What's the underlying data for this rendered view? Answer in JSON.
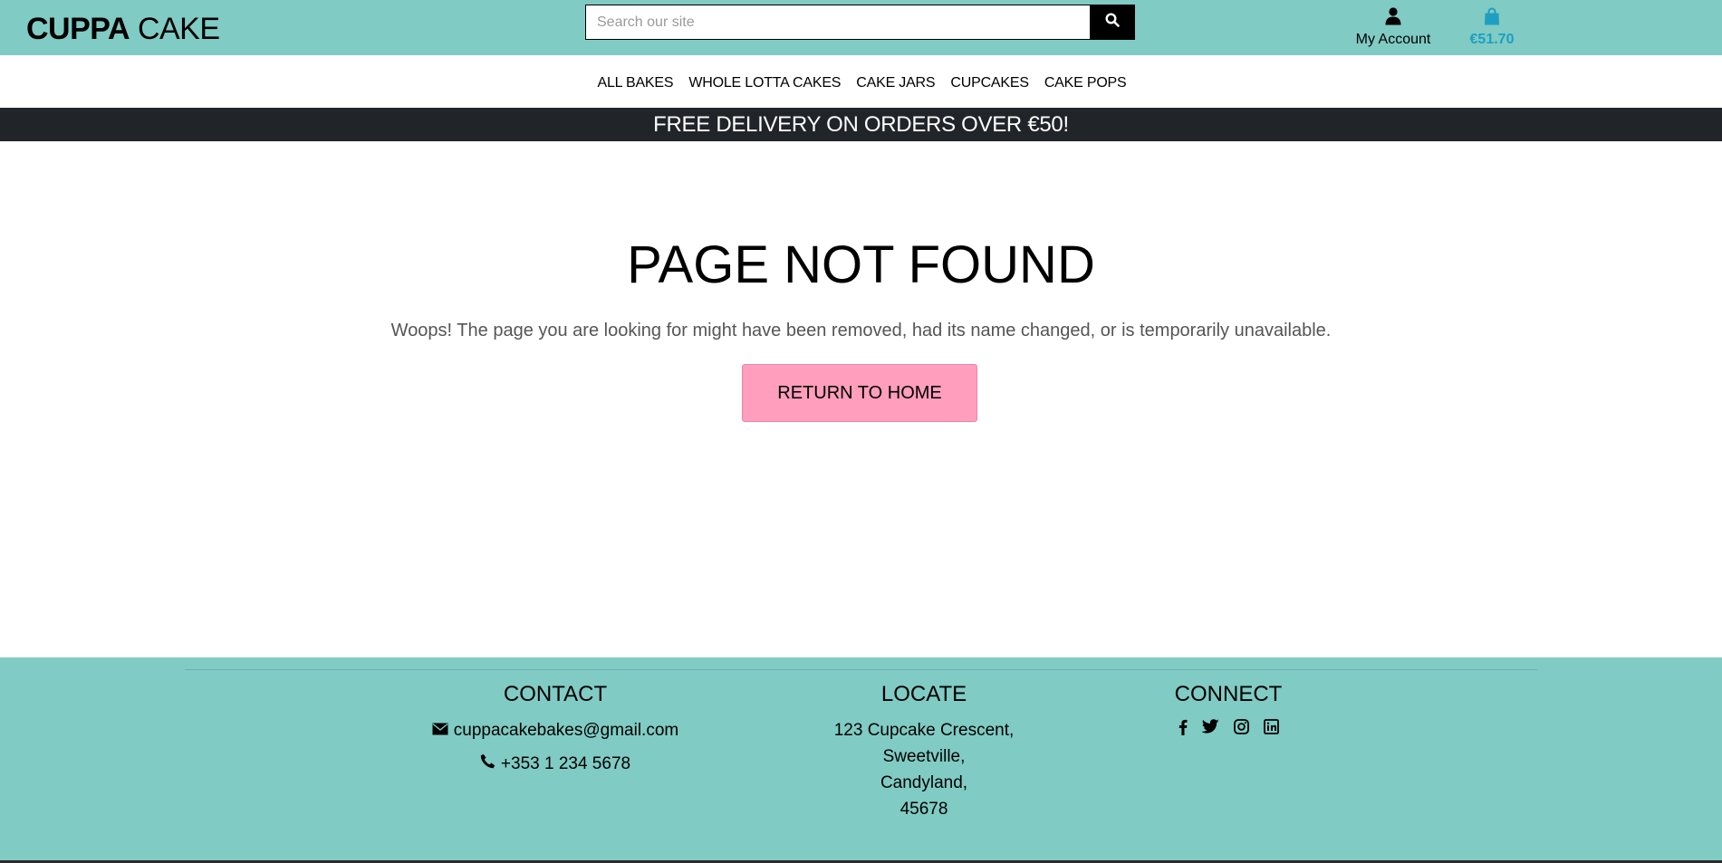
{
  "header": {
    "brand_bold": "CUPPA",
    "brand_rest": "CAKE",
    "search": {
      "placeholder": "Search our site",
      "icon": "search-icon"
    },
    "account": {
      "label": "My Account",
      "icon": "user-icon"
    },
    "bag": {
      "amount": "€51.70",
      "icon": "shopping-bag-icon"
    }
  },
  "nav": {
    "items": [
      {
        "label": "ALL BAKES"
      },
      {
        "label": "WHOLE LOTTA CAKES"
      },
      {
        "label": "CAKE JARS"
      },
      {
        "label": "CUPCAKES"
      },
      {
        "label": "CAKE POPS"
      }
    ]
  },
  "banner": {
    "text": "FREE DELIVERY ON ORDERS OVER €50!"
  },
  "main": {
    "title": "PAGE NOT FOUND",
    "message": "Woops! The page you are looking for might have been removed, had its name changed, or is temporarily unavailable.",
    "button_label": "RETURN TO HOME"
  },
  "footer": {
    "contact": {
      "heading": "CONTACT",
      "email": "cuppacakebakes@gmail.com",
      "phone": "+353 1 234 5678"
    },
    "locate": {
      "heading": "LOCATE",
      "address": [
        "123 Cupcake Crescent,",
        "Sweetville,",
        "Candyland,",
        "45678"
      ]
    },
    "connect": {
      "heading": "CONNECT",
      "icons": [
        "facebook-icon",
        "twitter-icon",
        "instagram-icon",
        "linkedin-icon"
      ]
    }
  },
  "colors": {
    "teal": "#80cbc4",
    "dark_banner": "#212529",
    "pink_button": "#ff9ebd",
    "bag_blue": "#1e9fc2"
  }
}
